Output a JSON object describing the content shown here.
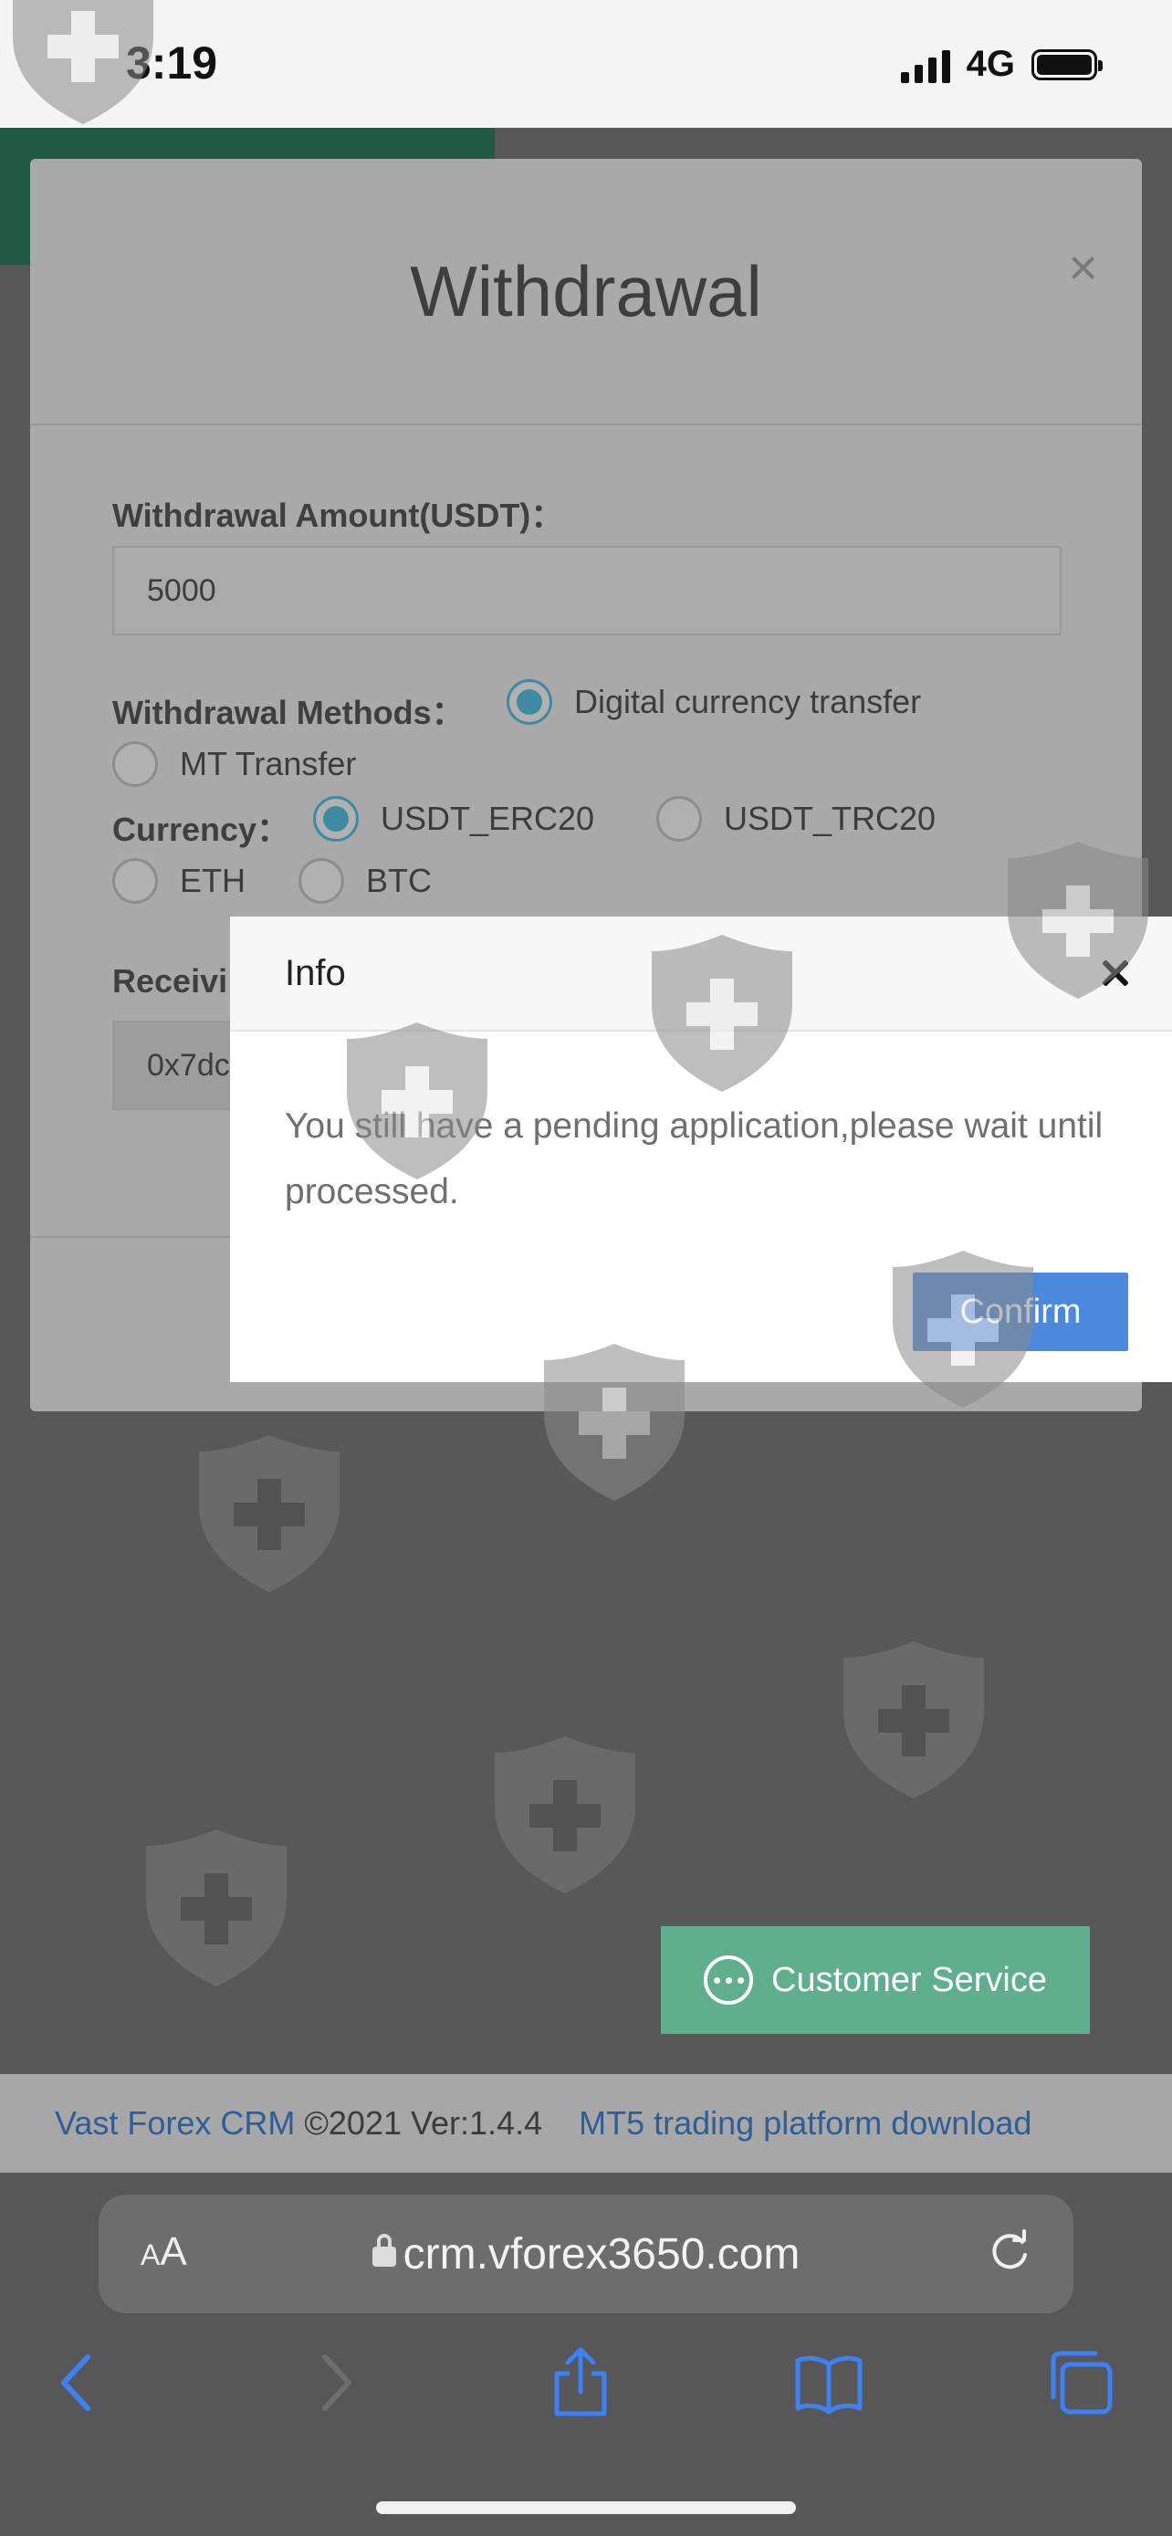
{
  "status_bar": {
    "time": "3:19",
    "network": "4G"
  },
  "withdrawal_modal": {
    "title": "Withdrawal",
    "close_glyph": "×",
    "amount_label": "Withdrawal Amount(USDT)：",
    "amount_value": "5000",
    "methods_label": "Withdrawal Methods：",
    "methods": [
      {
        "label": "Digital currency transfer",
        "selected": true
      },
      {
        "label": "MT Transfer",
        "selected": false
      }
    ],
    "currency_label": "Currency：",
    "currencies": [
      {
        "label": "USDT_ERC20",
        "selected": true
      },
      {
        "label": "USDT_TRC20",
        "selected": false
      },
      {
        "label": "ETH",
        "selected": false
      },
      {
        "label": "BTC",
        "selected": false
      }
    ],
    "receiving_label": "Receivi",
    "receiving_value": "0x7dc"
  },
  "info_dialog": {
    "title": "Info",
    "message": "You still have a pending application,please wait until processed.",
    "confirm_label": "Confirm"
  },
  "customer_service": {
    "label": "Customer Service",
    "icon": "chat-bubble-icon"
  },
  "footer": {
    "brand_link": "Vast Forex CRM",
    "copyright": " ©2021 Ver:1.4.4",
    "download_link": "MT5 trading platform download"
  },
  "browser": {
    "aa_small": "A",
    "aa_big": "A",
    "url": "crm.vforex3650.com"
  },
  "colors": {
    "accent_blue": "#4a89dc",
    "service_green": "#5faf8e",
    "radio_selected": "#3f8aa3"
  }
}
